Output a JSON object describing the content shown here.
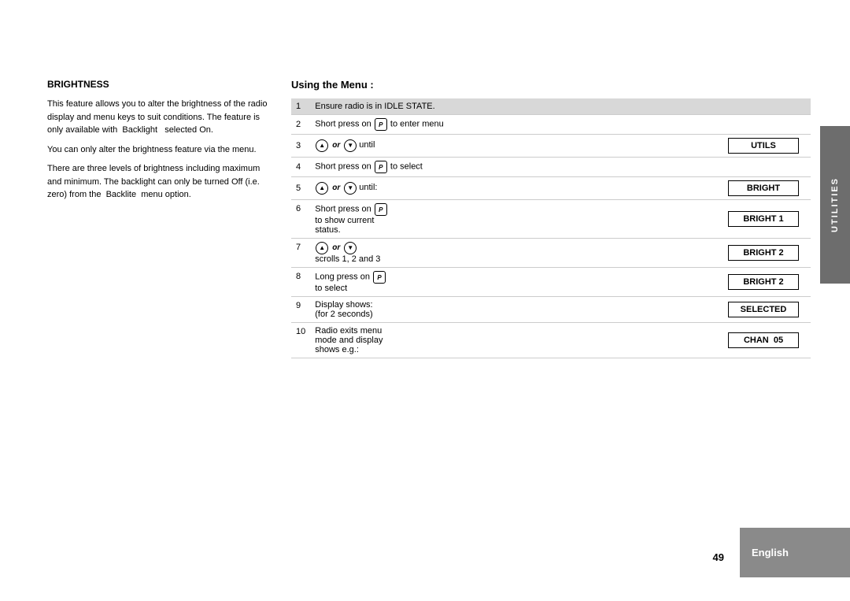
{
  "page": {
    "number": "49",
    "tab_utilities": "UTILITIES",
    "tab_english": "English"
  },
  "left_section": {
    "title": "BRIGHTNESS",
    "paragraphs": [
      "This feature allows you to alter the brightness of the radio display and menu keys to suit conditions. The feature is only available with  Backlight   selected On.",
      "You can only alter the brightness feature via the menu.",
      "There are three levels of brightness including maximum and minimum. The backlight can only be turned Off (i.e. zero) from the  Backlite  menu option."
    ]
  },
  "right_section": {
    "title": "Using the Menu :",
    "steps": [
      {
        "num": "1",
        "desc": "Ensure radio is in IDLE STATE.",
        "display": "",
        "highlight": true
      },
      {
        "num": "2",
        "desc": "Short press on [P] to enter menu",
        "display": "",
        "highlight": false
      },
      {
        "num": "3",
        "desc_parts": [
          "[▲] or [▼] until"
        ],
        "display": "UTILS",
        "highlight": false
      },
      {
        "num": "4",
        "desc": "Short press on [P] to select",
        "display": "",
        "highlight": false
      },
      {
        "num": "5",
        "desc_parts": [
          "[▲] or [▼] until:"
        ],
        "display": "BRIGHT",
        "highlight": false
      },
      {
        "num": "6",
        "desc": "Short press on [P] to show current status.",
        "display": "BRIGHT 1",
        "highlight": false
      },
      {
        "num": "7",
        "desc_parts": [
          "[▲] or [▼]",
          "scrolls 1, 2 and 3"
        ],
        "display": "BRIGHT 2",
        "highlight": false
      },
      {
        "num": "8",
        "desc": "Long press on [P] to select",
        "display": "BRIGHT 2",
        "highlight": false
      },
      {
        "num": "9",
        "desc": "Display shows: (for 2 seconds)",
        "display": "SELECTED",
        "highlight": false
      },
      {
        "num": "10",
        "desc": "Radio exits menu mode and display shows e.g.:",
        "display": "CHAN  05",
        "highlight": false
      }
    ]
  }
}
